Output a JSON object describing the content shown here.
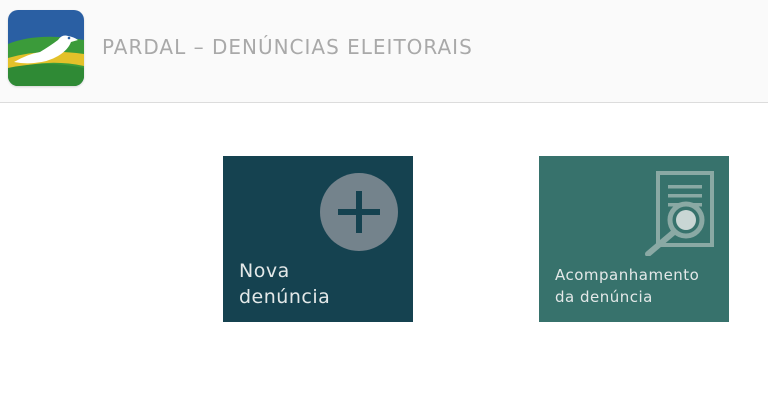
{
  "header": {
    "title": "PARDAL – DENÚNCIAS ELEITORAIS",
    "logo_icon": "pardal-bird-logo-icon"
  },
  "tiles": [
    {
      "label_line1": "Nova",
      "label_line2": "denúncia",
      "icon": "plus-circle-icon",
      "color": "#154250"
    },
    {
      "label_line1": "Acompanhamento",
      "label_line2": "da denúncia",
      "icon": "document-search-icon",
      "color": "#37726c"
    }
  ]
}
